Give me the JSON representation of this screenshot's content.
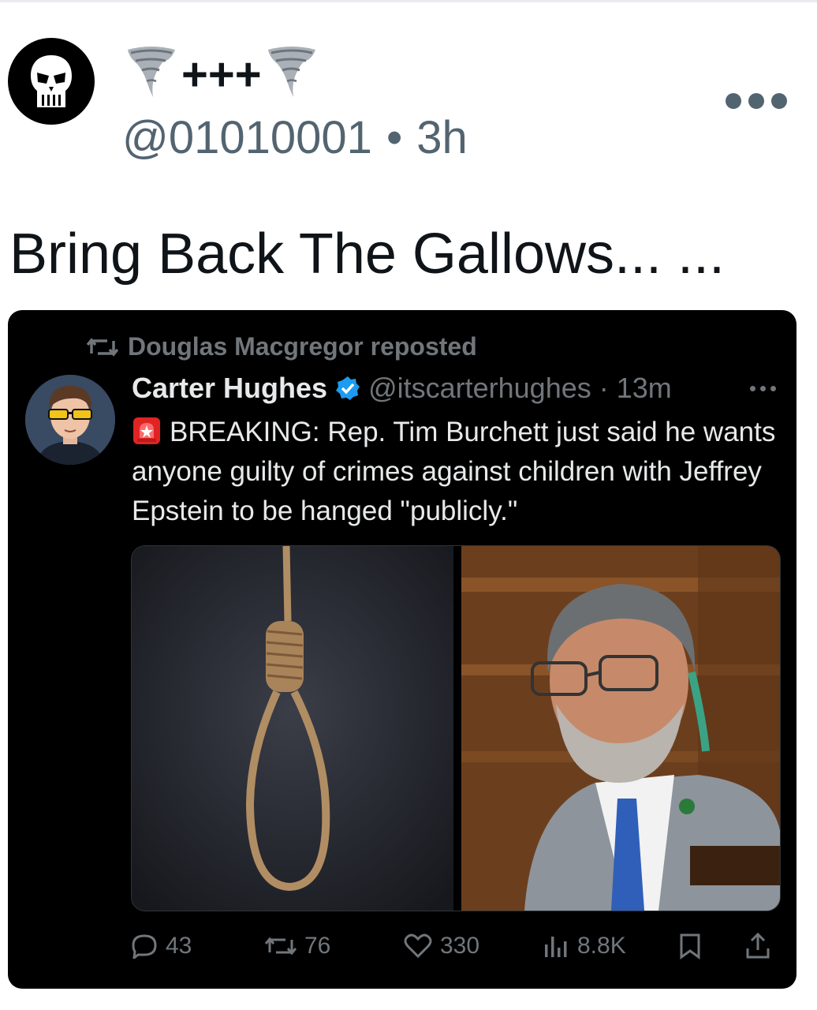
{
  "post": {
    "display_name_text": "+++",
    "display_name_decor_icon": "tornado-icon",
    "handle": "@01010001",
    "separator": "•",
    "time": "3h",
    "text": "Bring Back The Gallows... ..."
  },
  "embed": {
    "repost_label": "Douglas Macgregor reposted",
    "author_name": "Carter Hughes",
    "author_handle": "@itscarterhughes",
    "dot": "·",
    "time": "13m",
    "tweet_text": "BREAKING: Rep. Tim Burchett just said he wants anyone guilty of crimes against children with Jeffrey Epstein to be hanged \"publicly.\"",
    "stats": {
      "replies": "43",
      "reposts": "76",
      "likes": "330",
      "views": "8.8K"
    },
    "colors": {
      "background": "#000000",
      "verified": "#1d9bf0",
      "muted": "#71767b"
    }
  }
}
